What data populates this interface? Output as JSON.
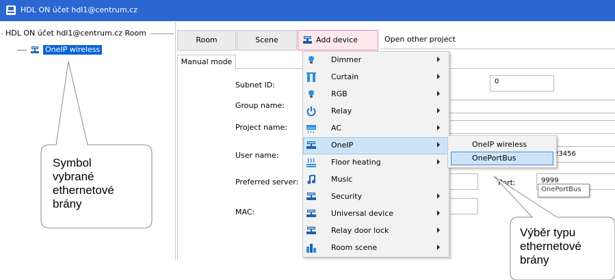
{
  "window": {
    "title": "HDL ON účet hdl1@centrum.cz"
  },
  "tree": {
    "header": "HDL ON účet hdl1@centrum.cz  Room",
    "selected_node": "OneIP wireless"
  },
  "tabs": {
    "room": "Room",
    "scene": "Scene",
    "add_device": "Add device",
    "open_other_project": "Open other project"
  },
  "form": {
    "mode_tab": "Manual mode",
    "subnet_label": "Subnet ID:",
    "subnet_value": "0",
    "group_label": "Group name:",
    "project_label": "Project name:",
    "user_label": "User name:",
    "user_value_partial": "23456",
    "server_label": "Preferred server:",
    "port_label": "Port:",
    "port_value": "9999",
    "mac_label": "MAC:"
  },
  "menu": {
    "items": [
      {
        "label": "Dimmer",
        "icon": "bulb-icon",
        "arrow": true
      },
      {
        "label": "Curtain",
        "icon": "curtain-icon",
        "arrow": true
      },
      {
        "label": "RGB",
        "icon": "rgb-bulb-icon",
        "arrow": true
      },
      {
        "label": "Relay",
        "icon": "power-icon",
        "arrow": true
      },
      {
        "label": "AC",
        "icon": "ac-icon",
        "arrow": true
      },
      {
        "label": "OneIP",
        "icon": "gateway-icon",
        "arrow": true,
        "highlighted": true
      },
      {
        "label": "Floor heating",
        "icon": "floor-heating-icon",
        "arrow": true
      },
      {
        "label": "Music",
        "icon": "music-note-icon",
        "arrow": false
      },
      {
        "label": "Security",
        "icon": "security-icon",
        "arrow": true
      },
      {
        "label": "Universal device",
        "icon": "universal-device-icon",
        "arrow": true
      },
      {
        "label": "Relay door lock",
        "icon": "door-lock-icon",
        "arrow": true
      },
      {
        "label": "Room scene",
        "icon": "room-scene-icon",
        "arrow": true
      }
    ]
  },
  "submenu": {
    "items": [
      {
        "label": "OneIP wireless"
      },
      {
        "label": "OnePortBus",
        "highlighted": true
      }
    ]
  },
  "tooltip": {
    "text": "OnePortBus"
  },
  "callouts": {
    "left": "Symbol\nvybrané\nethernetové\nbrány",
    "right": "Výběr typu\nethernetové\nbrány"
  },
  "colors": {
    "title_bar": "#2b67d1",
    "selection": "#0a64d6",
    "menu_highlight": "#cce4f7",
    "add_device_tab": "#fde8ee"
  }
}
